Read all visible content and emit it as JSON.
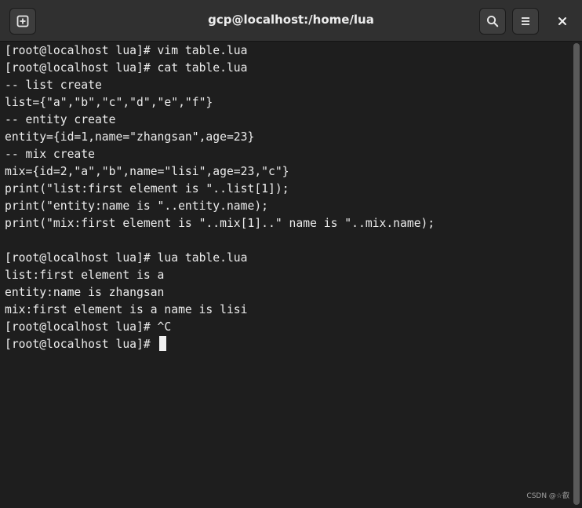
{
  "window": {
    "title": "gcp@localhost:/home/lua"
  },
  "header": {
    "new_tab_icon": "new-tab-icon",
    "search_icon": "search-icon",
    "menu_icon": "hamburger-menu-icon",
    "close_icon": "close-icon"
  },
  "terminal": {
    "lines": [
      "[root@localhost lua]# vim table.lua",
      "[root@localhost lua]# cat table.lua",
      "-- list create",
      "list={\"a\",\"b\",\"c\",\"d\",\"e\",\"f\"}",
      "-- entity create",
      "entity={id=1,name=\"zhangsan\",age=23}",
      "-- mix create",
      "mix={id=2,\"a\",\"b\",name=\"lisi\",age=23,\"c\"}",
      "print(\"list:first element is \"..list[1]);",
      "print(\"entity:name is \"..entity.name);",
      "print(\"mix:first element is \"..mix[1]..\" name is \"..mix.name);",
      "",
      "[root@localhost lua]# lua table.lua",
      "list:first element is a",
      "entity:name is zhangsan",
      "mix:first element is a name is lisi",
      "[root@localhost lua]# ^C"
    ],
    "prompt": "[root@localhost lua]# "
  },
  "watermark": "CSDN @☆叡",
  "colors": {
    "background": "#1e1e1e",
    "titlebar": "#303030",
    "foreground": "#ececec"
  }
}
